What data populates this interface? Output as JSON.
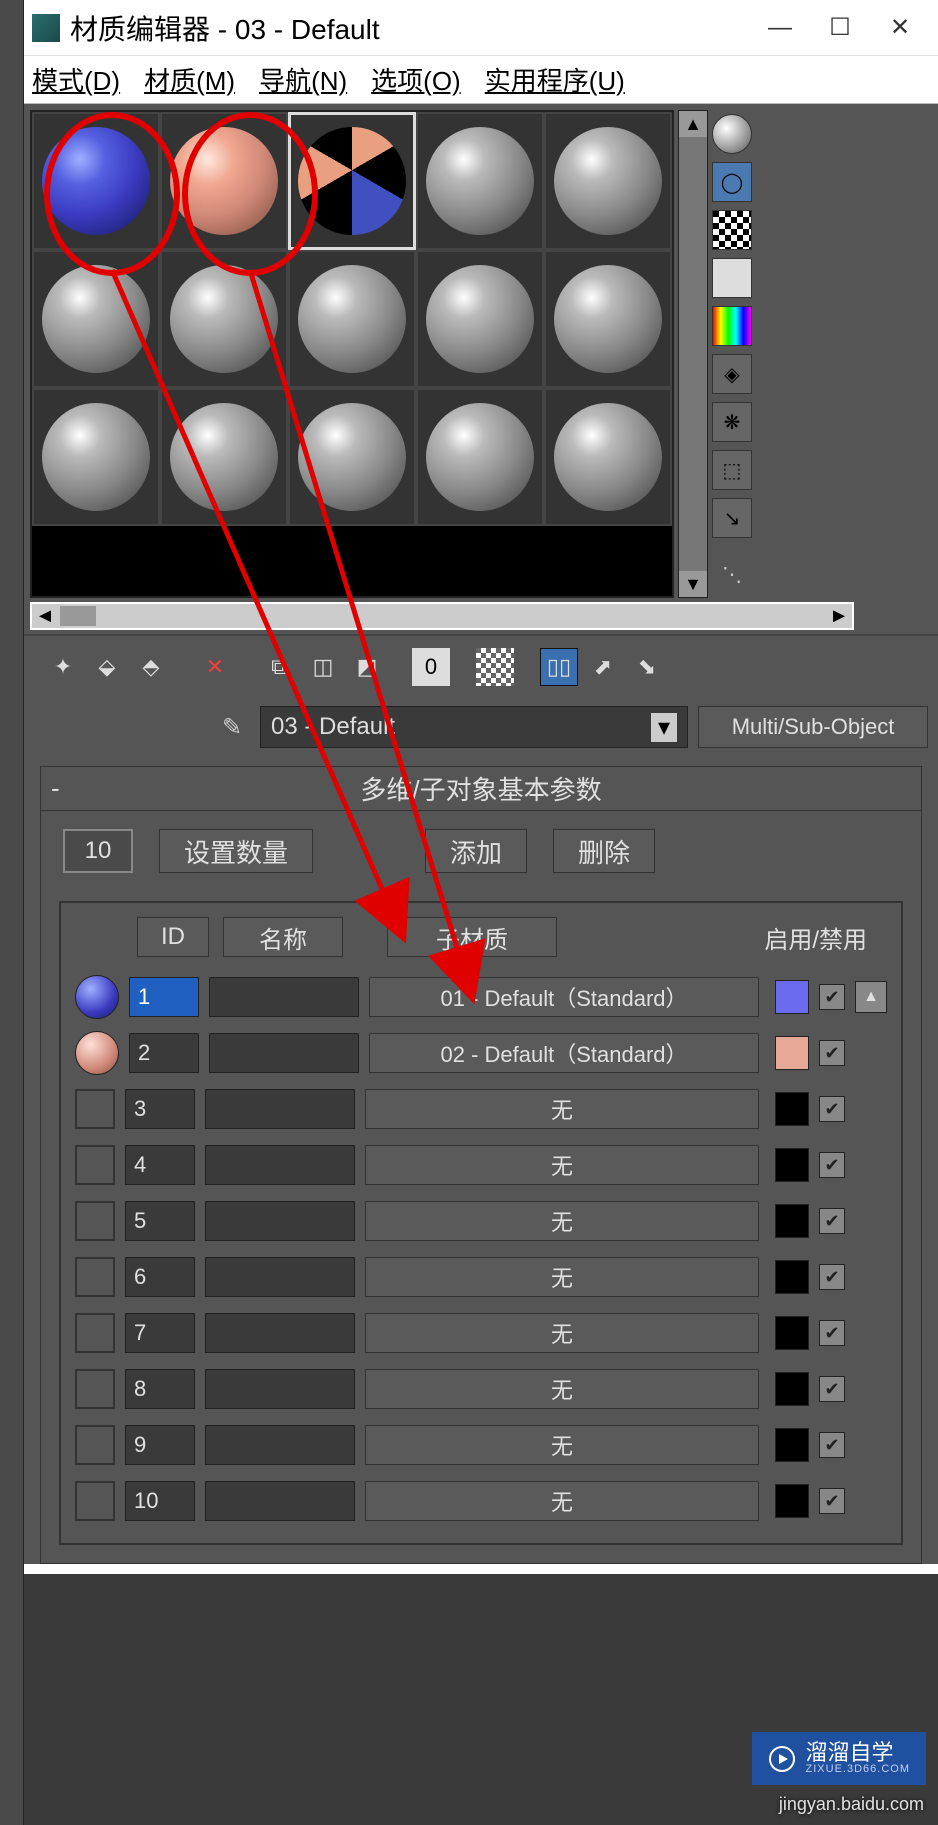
{
  "window": {
    "title": "材质编辑器 - 03 - Default"
  },
  "menu": {
    "mode": "模式(D)",
    "material": "材质(M)",
    "navigate": "导航(N)",
    "options": "选项(O)",
    "utilities": "实用程序(U)"
  },
  "name_row": {
    "current_name": "03 - Default",
    "type_button": "Multi/Sub-Object"
  },
  "rollout": {
    "title": "多维/子对象基本参数",
    "count": "10",
    "set_count": "设置数量",
    "add": "添加",
    "delete": "删除"
  },
  "sub_header": {
    "id": "ID",
    "name": "名称",
    "submat": "子材质",
    "enable": "启用/禁用"
  },
  "sub_rows": [
    {
      "id": "1",
      "submat": "01 - Default（Standard）",
      "swatch": "blue",
      "color": "#6b6bf0",
      "selected": true
    },
    {
      "id": "2",
      "submat": "02 - Default（Standard）",
      "swatch": "pink",
      "color": "#e8a898",
      "selected": false
    },
    {
      "id": "3",
      "submat": "无",
      "swatch": "empty",
      "color": "#000000",
      "selected": false
    },
    {
      "id": "4",
      "submat": "无",
      "swatch": "empty",
      "color": "#000000",
      "selected": false
    },
    {
      "id": "5",
      "submat": "无",
      "swatch": "empty",
      "color": "#000000",
      "selected": false
    },
    {
      "id": "6",
      "submat": "无",
      "swatch": "empty",
      "color": "#000000",
      "selected": false
    },
    {
      "id": "7",
      "submat": "无",
      "swatch": "empty",
      "color": "#000000",
      "selected": false
    },
    {
      "id": "8",
      "submat": "无",
      "swatch": "empty",
      "color": "#000000",
      "selected": false
    },
    {
      "id": "9",
      "submat": "无",
      "swatch": "empty",
      "color": "#000000",
      "selected": false
    },
    {
      "id": "10",
      "submat": "无",
      "swatch": "empty",
      "color": "#000000",
      "selected": false
    }
  ],
  "watermark": {
    "brand": "溜溜自学",
    "sub": "ZIXUE.3D66.COM",
    "footer": "jingyan.baidu.com"
  },
  "samples": {
    "selected_index": 2,
    "cells": [
      "blue",
      "pink",
      "multi",
      "gray",
      "gray",
      "gray",
      "gray",
      "gray",
      "gray",
      "gray",
      "gray",
      "gray",
      "gray",
      "gray",
      "gray"
    ]
  }
}
